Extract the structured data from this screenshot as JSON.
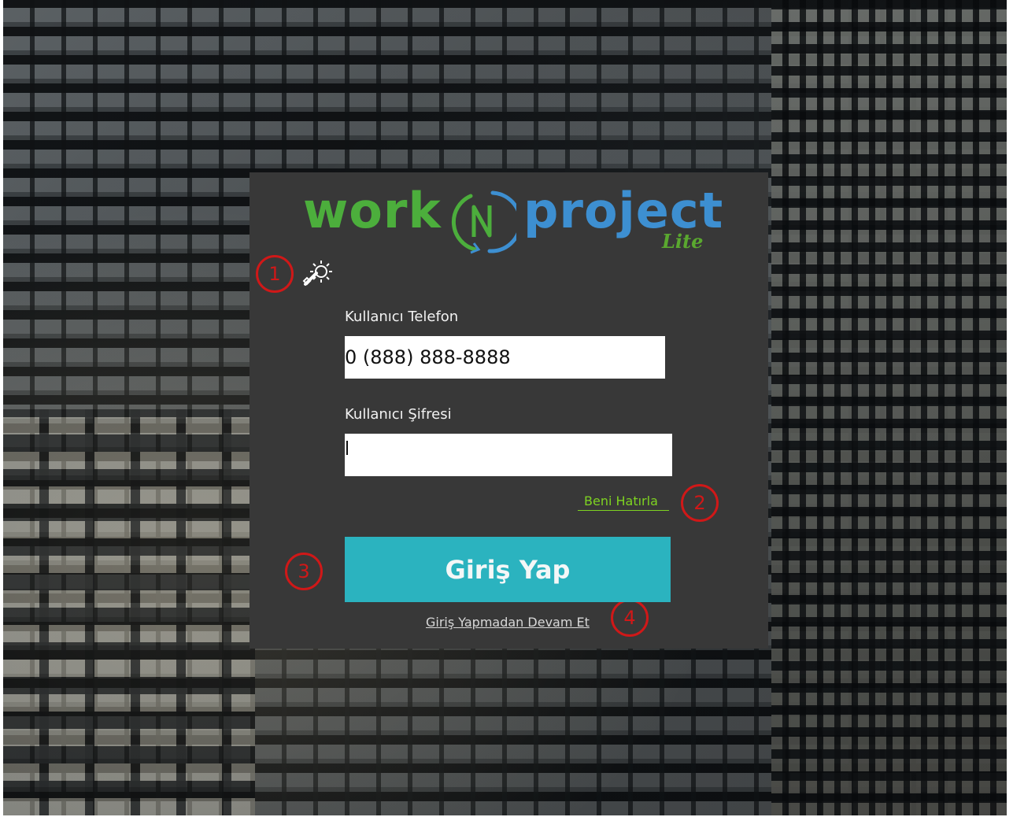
{
  "logo": {
    "word_left": "work",
    "word_right": "project",
    "edition": "Lite",
    "n_letter": "N"
  },
  "colors": {
    "panel": "#383838",
    "logo_green": "#4cae3c",
    "logo_blue": "#3d8fd1",
    "button": "#2bb3bf",
    "link_green": "#7ed321",
    "annotation_red": "#d01818"
  },
  "settings": {
    "icon": "gear-wrench-icon"
  },
  "form": {
    "phone_label": "Kullanıcı Telefon",
    "phone_value": "0 (888) 888-8888",
    "password_label": "Kullanıcı Şifresi",
    "password_value": ""
  },
  "remember_me": "Beni Hatırla",
  "login_button": "Giriş Yap",
  "skip_link": "Giriş Yapmadan Devam Et",
  "annotations": [
    "1",
    "2",
    "3",
    "4"
  ]
}
